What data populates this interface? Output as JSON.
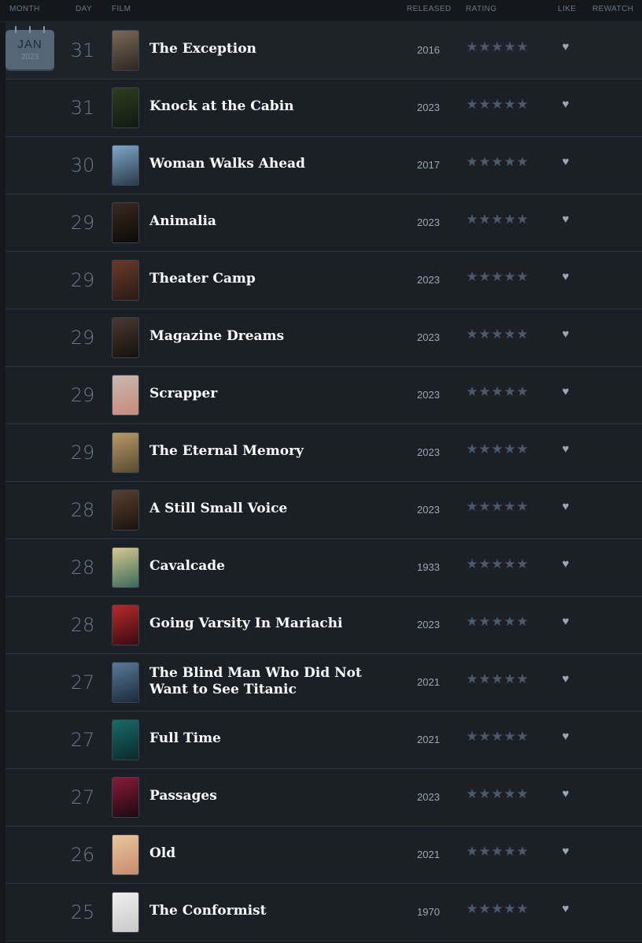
{
  "header": {
    "month": "MONTH",
    "day": "DAY",
    "film": "FILM",
    "released": "RELEASED",
    "rating": "RATING",
    "like": "LIKE",
    "rewatch": "REWATCH"
  },
  "calendar": {
    "month": "JAN",
    "year": "2023"
  },
  "icons": {
    "star": "star-icon",
    "like": "heart-icon",
    "calendar": "calendar-icon"
  },
  "colors": {
    "background": "#14181c",
    "row": "#1b2026",
    "star_empty": "#4d5966",
    "heart": "#99a8b5"
  },
  "entries": [
    {
      "day": "31",
      "title": "The Exception",
      "year": "2016",
      "poster": [
        "#7a6a5a",
        "#2e2620"
      ]
    },
    {
      "day": "31",
      "title": "Knock at the Cabin",
      "year": "2023",
      "poster": [
        "#2f3d20",
        "#0f1a10"
      ]
    },
    {
      "day": "30",
      "title": "Woman Walks Ahead",
      "year": "2017",
      "poster": [
        "#7fa8c8",
        "#2a3a4a"
      ]
    },
    {
      "day": "29",
      "title": "Animalia",
      "year": "2023",
      "poster": [
        "#3a2a1e",
        "#0c0a08"
      ]
    },
    {
      "day": "29",
      "title": "Theater Camp",
      "year": "2023",
      "poster": [
        "#6a3a2a",
        "#2a1a14"
      ]
    },
    {
      "day": "29",
      "title": "Magazine Dreams",
      "year": "2023",
      "poster": [
        "#4a3a30",
        "#15100c"
      ]
    },
    {
      "day": "29",
      "title": "Scrapper",
      "year": "2023",
      "poster": [
        "#c8b8b0",
        "#c88a7a"
      ]
    },
    {
      "day": "29",
      "title": "The Eternal Memory",
      "year": "2023",
      "poster": [
        "#b89a6a",
        "#5a4a30"
      ]
    },
    {
      "day": "28",
      "title": "A Still Small Voice",
      "year": "2023",
      "poster": [
        "#5a4030",
        "#1a120c"
      ]
    },
    {
      "day": "28",
      "title": "Cavalcade",
      "year": "1933",
      "poster": [
        "#d8c890",
        "#3a6a5a"
      ]
    },
    {
      "day": "28",
      "title": "Going Varsity In Mariachi",
      "year": "2023",
      "poster": [
        "#b82a2a",
        "#3a0a10"
      ]
    },
    {
      "day": "27",
      "title": "The Blind Man Who Did Not Want to See Titanic",
      "year": "2021",
      "poster": [
        "#5a7a9a",
        "#1a2a3a"
      ]
    },
    {
      "day": "27",
      "title": "Full Time",
      "year": "2021",
      "poster": [
        "#1a6a6a",
        "#0a2a2a"
      ]
    },
    {
      "day": "27",
      "title": "Passages",
      "year": "2023",
      "poster": [
        "#8a1a3a",
        "#1a0a10"
      ]
    },
    {
      "day": "26",
      "title": "Old",
      "year": "2021",
      "poster": [
        "#e8c8a0",
        "#c88a6a"
      ]
    },
    {
      "day": "25",
      "title": "The Conformist",
      "year": "1970",
      "poster": [
        "#f0f0f0",
        "#c8c8c8"
      ]
    }
  ]
}
